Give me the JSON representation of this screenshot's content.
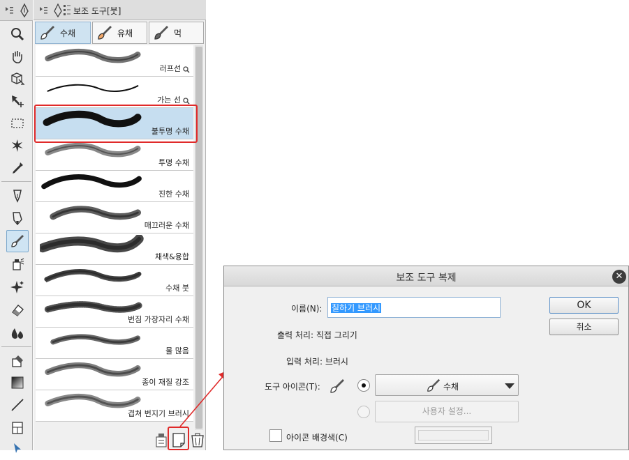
{
  "subtool_panel": {
    "title": "보조 도구[붓]",
    "group_tabs": [
      {
        "label": "수채",
        "active": true
      },
      {
        "label": "유채",
        "active": false
      },
      {
        "label": "먹",
        "active": false
      }
    ],
    "brushes": [
      {
        "name": "러프선",
        "has_search_icon": true
      },
      {
        "name": "가는 선",
        "has_search_icon": true
      },
      {
        "name": "불투명 수채",
        "selected": true
      },
      {
        "name": "투명 수채"
      },
      {
        "name": "진한 수채"
      },
      {
        "name": "매끄러운 수채"
      },
      {
        "name": "채색&융합"
      },
      {
        "name": "수채 붓"
      },
      {
        "name": "번짐 가장자리 수채"
      },
      {
        "name": "물 많음"
      },
      {
        "name": "종이 재질 강조"
      },
      {
        "name": "겹쳐 번지기 브러시"
      }
    ]
  },
  "dialog": {
    "title": "보조 도구 복제",
    "name_label": "이름(N):",
    "name_value": "칠하기 브러시",
    "output_label": "출력 처리: 직접 그리기",
    "input_label": "입력 처리: 브러시",
    "tool_icon_label": "도구 아이콘(T):",
    "icon_select_value": "수채",
    "custom_button": "사용자 설정...",
    "bg_color_label": "아이콘 배경색(C)",
    "ok_button": "OK",
    "cancel_button": "취소"
  },
  "colors": {
    "highlight": "#e02a2a",
    "selected_row": "#c6def0",
    "active_tab": "#cfe3f1"
  }
}
